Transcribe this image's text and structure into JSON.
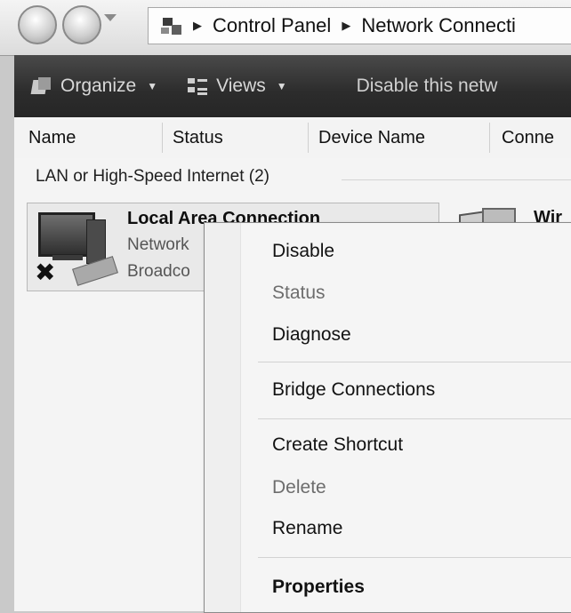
{
  "address_bar": {
    "breadcrumb": [
      "Control Panel",
      "Network Connecti"
    ]
  },
  "toolbar": {
    "organize_label": "Organize",
    "views_label": "Views",
    "disable_label": "Disable this netw"
  },
  "columns": [
    "Name",
    "Status",
    "Device Name",
    "Conne"
  ],
  "group": {
    "title": "LAN or High-Speed Internet (2)"
  },
  "connections": [
    {
      "name": "Local Area Connection",
      "line2": "Network",
      "line3": "Broadco",
      "icon": "wired-network-disabled-icon"
    },
    {
      "name": "Wir",
      "icon": "wireless-network-icon"
    }
  ],
  "context_menu": {
    "items": [
      {
        "label": "Disable",
        "state": "normal"
      },
      {
        "label": "Status",
        "state": "disabled"
      },
      {
        "label": "Diagnose",
        "state": "normal"
      },
      {
        "label": "Bridge Connections",
        "state": "normal"
      },
      {
        "label": "Create Shortcut",
        "state": "normal"
      },
      {
        "label": "Delete",
        "state": "disabled"
      },
      {
        "label": "Rename",
        "state": "normal"
      },
      {
        "label": "Properties",
        "state": "default"
      }
    ]
  }
}
